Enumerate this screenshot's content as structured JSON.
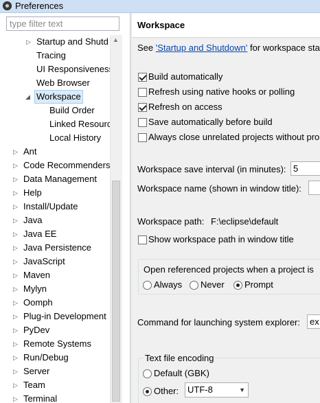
{
  "window": {
    "title": "Preferences"
  },
  "filter": {
    "placeholder": "type filter text"
  },
  "tree": {
    "items": [
      {
        "label": "Startup and Shutd",
        "expander": "▷"
      },
      {
        "label": "Tracing",
        "expander": ""
      },
      {
        "label": "UI Responsiveness",
        "expander": ""
      },
      {
        "label": "Web Browser",
        "expander": ""
      },
      {
        "label": "Workspace",
        "expander": "◢"
      },
      {
        "label": "Build Order",
        "expander": ""
      },
      {
        "label": "Linked Resources",
        "expander": ""
      },
      {
        "label": "Local History",
        "expander": ""
      },
      {
        "label": "Ant",
        "expander": "▷"
      },
      {
        "label": "Code Recommenders",
        "expander": "▷"
      },
      {
        "label": "Data Management",
        "expander": "▷"
      },
      {
        "label": "Help",
        "expander": "▷"
      },
      {
        "label": "Install/Update",
        "expander": "▷"
      },
      {
        "label": "Java",
        "expander": "▷"
      },
      {
        "label": "Java EE",
        "expander": "▷"
      },
      {
        "label": "Java Persistence",
        "expander": "▷"
      },
      {
        "label": "JavaScript",
        "expander": "▷"
      },
      {
        "label": "Maven",
        "expander": "▷"
      },
      {
        "label": "Mylyn",
        "expander": "▷"
      },
      {
        "label": "Oomph",
        "expander": "▷"
      },
      {
        "label": "Plug-in Development",
        "expander": "▷"
      },
      {
        "label": "PyDev",
        "expander": "▷"
      },
      {
        "label": "Remote Systems",
        "expander": "▷"
      },
      {
        "label": "Run/Debug",
        "expander": "▷"
      },
      {
        "label": "Server",
        "expander": "▷"
      },
      {
        "label": "Team",
        "expander": "▷"
      },
      {
        "label": "Terminal",
        "expander": "▷"
      }
    ]
  },
  "page": {
    "title": "Workspace",
    "see_prefix": "See ",
    "see_link": "'Startup and Shutdown'",
    "see_suffix": " for workspace sta",
    "options": [
      {
        "label": "Build automatically",
        "checked": true
      },
      {
        "label": "Refresh using native hooks or polling",
        "checked": false
      },
      {
        "label": "Refresh on access",
        "checked": true
      },
      {
        "label": "Save automatically before build",
        "checked": false
      },
      {
        "label": "Always close unrelated projects without pro",
        "checked": false
      }
    ],
    "save_interval_label": "Workspace save interval (in minutes):",
    "save_interval_value": "5",
    "workspace_name_label": "Workspace name (shown in window title):",
    "workspace_name_value": "",
    "workspace_path_label": "Workspace path:",
    "workspace_path_value": "F:\\eclipse\\default",
    "show_path_label": "Show workspace path in window title",
    "show_path_checked": false,
    "open_projects_label": "Open referenced projects when a project is",
    "open_projects_options": [
      {
        "label": "Always",
        "selected": false
      },
      {
        "label": "Never",
        "selected": false
      },
      {
        "label": "Prompt",
        "selected": true
      }
    ],
    "explorer_label": "Command for launching system explorer:",
    "explorer_value": "ex",
    "encoding_group_label": "Text file encoding",
    "encoding_default_label": "Default (GBK)",
    "encoding_default_selected": false,
    "encoding_other_label": "Other:",
    "encoding_other_selected": true,
    "encoding_value": "UTF-8"
  }
}
